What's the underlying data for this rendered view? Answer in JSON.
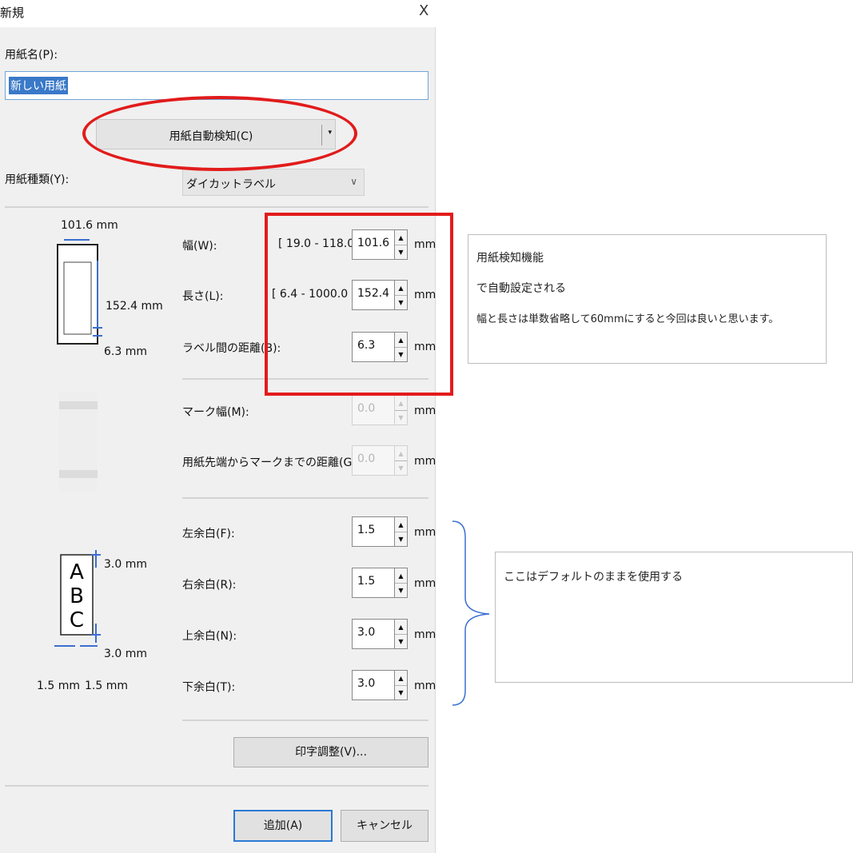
{
  "dialog": {
    "title": "新規",
    "close_glyph": "X",
    "paper_name_label": "用紙名(P):",
    "paper_name_value": "新しい用紙",
    "auto_detect_label": "用紙自動検知(C)",
    "paper_type_label": "用紙種類(Y):",
    "paper_type_value": "ダイカットラベル",
    "size_fields": [
      {
        "label": "幅(W):",
        "range": "[ 19.0 - 118.0 ]",
        "value": "101.6",
        "unit": "mm"
      },
      {
        "label": "長さ(L):",
        "range": "[ 6.4 - 1000.0 ]",
        "value": "152.4",
        "unit": "mm"
      },
      {
        "label": "ラベル間の距離(B):",
        "range": "",
        "value": "6.3",
        "unit": "mm"
      }
    ],
    "mark_fields": [
      {
        "label": "マーク幅(M):",
        "value": "0.0",
        "unit": "mm"
      },
      {
        "label": "用紙先端からマークまでの距離(G):",
        "value": "0.0",
        "unit": "mm"
      }
    ],
    "margin_fields": [
      {
        "label": "左余白(F):",
        "value": "1.5",
        "unit": "mm"
      },
      {
        "label": "右余白(R):",
        "value": "1.5",
        "unit": "mm"
      },
      {
        "label": "上余白(N):",
        "value": "3.0",
        "unit": "mm"
      },
      {
        "label": "下余白(T):",
        "value": "3.0",
        "unit": "mm"
      }
    ],
    "print_adjust_label": "印字調整(V)...",
    "add_label": "追加(A)",
    "cancel_label": "キャンセル",
    "preview": {
      "width_dim": "101.6 mm",
      "length_dim": "152.4 mm",
      "gap_dim": "6.3 mm",
      "top_margin_dim": "3.0 mm",
      "bottom_margin_dim": "3.0 mm",
      "left_margin_dim": "1.5 mm",
      "right_margin_dim": "1.5 mm",
      "sample_letters": "A B C"
    }
  },
  "annotations": {
    "note1_lines": [
      "用紙検知機能",
      "で自動設定される",
      "幅と長さは単数省略して60mmにすると今回は良いと思います。"
    ],
    "note2_text": "ここはデフォルトのままを使用する",
    "highlight_color": "#e21b1b",
    "brace_color": "#3b6fd1"
  },
  "icons": {
    "up_arrow": "▲",
    "down_arrow": "▼",
    "dropdown_arrow": "▾",
    "chevron_down": "∨"
  }
}
